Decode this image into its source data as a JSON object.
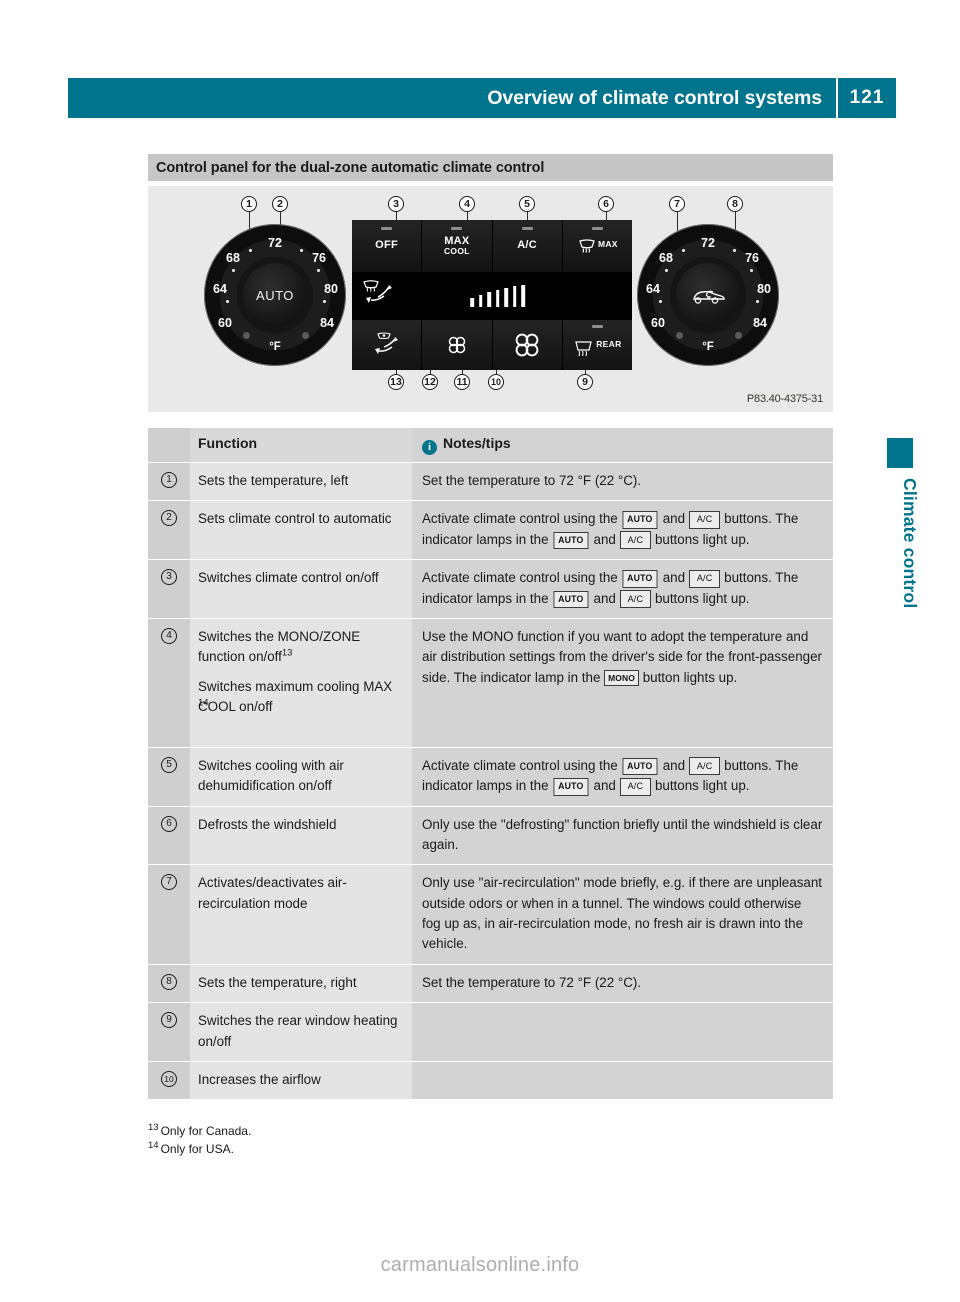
{
  "header": {
    "title": "Overview of climate control systems",
    "page_number": "121"
  },
  "section": {
    "band_title": "Control panel for the dual-zone automatic climate control"
  },
  "figure": {
    "image_code": "P83.40-4375-31",
    "callouts": [
      "1",
      "2",
      "3",
      "4",
      "5",
      "6",
      "7",
      "8",
      "9",
      "10",
      "11",
      "12",
      "13"
    ],
    "panel": {
      "left_dial": {
        "hub_label": "AUTO",
        "unit": "°F",
        "scale": [
          "60",
          "64",
          "68",
          "72",
          "76",
          "80",
          "84"
        ]
      },
      "right_dial": {
        "hub_label": "air-recirculation-car-icon",
        "unit": "°F",
        "scale": [
          "60",
          "64",
          "68",
          "72",
          "76",
          "80",
          "84"
        ]
      },
      "top_buttons": [
        {
          "label": "OFF",
          "sub": ""
        },
        {
          "label": "MAX",
          "sub": "COOL"
        },
        {
          "label": "A/C",
          "sub": ""
        },
        {
          "label": "MAX",
          "sub": "",
          "icon": "windshield-defrost-icon"
        }
      ],
      "bottom_buttons": [
        {
          "icon": "air-distribution-lower-icon"
        },
        {
          "icon": "fan-decrease-icon"
        },
        {
          "icon": "fan-increase-icon"
        },
        {
          "icon": "rear-window-defrost-icon",
          "label": "REAR"
        }
      ],
      "mid_strip": {
        "left_icon": "air-distribution-icon",
        "fan_bars": 7
      }
    }
  },
  "table": {
    "headers": {
      "function": "Function",
      "notes": "Notes/tips",
      "notes_icon": "info-icon"
    },
    "rows": [
      {
        "num": "1",
        "function": "Sets the temperature, left",
        "note_parts": [
          {
            "t": "text",
            "v": "Set the temperature to 72 °F (22 °C)."
          }
        ]
      },
      {
        "num": "2",
        "function": "Sets climate control to automatic",
        "note_parts": [
          {
            "t": "text",
            "v": "Activate climate control using the "
          },
          {
            "t": "key",
            "v": "AUTO",
            "style": "auto"
          },
          {
            "t": "text",
            "v": " and "
          },
          {
            "t": "key",
            "v": "A/C",
            "style": "ac"
          },
          {
            "t": "text",
            "v": " buttons. The indicator lamps in the "
          },
          {
            "t": "key",
            "v": "AUTO",
            "style": "auto"
          },
          {
            "t": "text",
            "v": " and "
          },
          {
            "t": "key",
            "v": "A/C",
            "style": "ac"
          },
          {
            "t": "text",
            "v": " buttons light up."
          }
        ]
      },
      {
        "num": "3",
        "function": "Switches climate control on/off",
        "note_parts": [
          {
            "t": "text",
            "v": "Activate climate control using the "
          },
          {
            "t": "key",
            "v": "AUTO",
            "style": "auto"
          },
          {
            "t": "text",
            "v": " and "
          },
          {
            "t": "key",
            "v": "A/C",
            "style": "ac"
          },
          {
            "t": "text",
            "v": " buttons. The indicator lamps in the "
          },
          {
            "t": "key",
            "v": "AUTO",
            "style": "auto"
          },
          {
            "t": "text",
            "v": " and "
          },
          {
            "t": "key",
            "v": "A/C",
            "style": "ac"
          },
          {
            "t": "text",
            "v": " buttons light up."
          }
        ]
      },
      {
        "num": "4",
        "function": "Switches the MONO/ZONE function on/off",
        "function_footnote": "13",
        "function_sub": "Switches maximum cooling MAX COOL on/off",
        "function_sub_footnote": "14",
        "note_parts": [
          {
            "t": "text",
            "v": "Use the MONO function if you want to adopt the temperature and air distribution settings from the driver's side for the front-passenger side. The indicator lamp in the "
          },
          {
            "t": "key",
            "v": "MONO",
            "style": "mono"
          },
          {
            "t": "text",
            "v": " button lights up."
          }
        ]
      },
      {
        "num": "5",
        "function": "Switches cooling with air dehumidification on/off",
        "note_parts": [
          {
            "t": "text",
            "v": "Activate climate control using the "
          },
          {
            "t": "key",
            "v": "AUTO",
            "style": "auto"
          },
          {
            "t": "text",
            "v": " and "
          },
          {
            "t": "key",
            "v": "A/C",
            "style": "ac"
          },
          {
            "t": "text",
            "v": " buttons. The indicator lamps in the "
          },
          {
            "t": "key",
            "v": "AUTO",
            "style": "auto"
          },
          {
            "t": "text",
            "v": " and "
          },
          {
            "t": "key",
            "v": "A/C",
            "style": "ac"
          },
          {
            "t": "text",
            "v": " buttons light up."
          }
        ]
      },
      {
        "num": "6",
        "function": "Defrosts the windshield",
        "note_parts": [
          {
            "t": "text",
            "v": "Only use the \"defrosting\" function briefly until the windshield is clear again."
          }
        ]
      },
      {
        "num": "7",
        "function": "Activates/deactivates air-recirculation mode",
        "note_parts": [
          {
            "t": "text",
            "v": "Only use \"air-recirculation\" mode briefly, e.g. if there are unpleasant outside odors or when in a tunnel. The windows could otherwise fog up as, in air-recirculation mode, no fresh air is drawn into the vehicle."
          }
        ]
      },
      {
        "num": "8",
        "function": "Sets the temperature, right",
        "note_parts": [
          {
            "t": "text",
            "v": "Set the temperature to 72 °F (22 °C)."
          }
        ]
      },
      {
        "num": "9",
        "function": "Switches the rear window heating on/off",
        "note_parts": []
      },
      {
        "num": "10",
        "function": "Increases the airflow",
        "note_parts": []
      }
    ]
  },
  "footnotes": [
    {
      "marker": "13",
      "text": "Only for Canada."
    },
    {
      "marker": "14",
      "text": "Only for USA."
    }
  ],
  "side_tab": {
    "label": "Climate control"
  },
  "watermark": {
    "text": "carmanualsonline.info"
  },
  "colors": {
    "accent_teal": "#00748c",
    "band_gray": "#c6c6c6",
    "figure_bg": "#e9e9e9",
    "row_num_bg": "#cfcfcf",
    "row_fn_bg": "#e4e4e4",
    "row_note_bg": "#d3d3d3"
  }
}
